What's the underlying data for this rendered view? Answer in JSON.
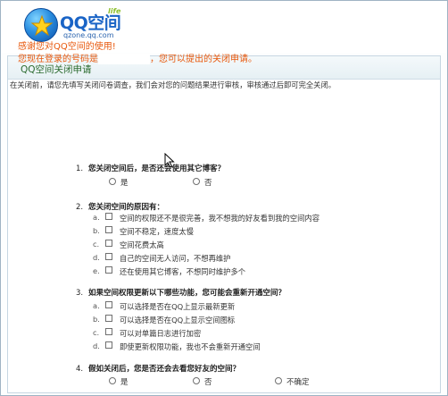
{
  "header": {
    "logo_text": "QQ空间",
    "logo_badge": "life",
    "logo_domain": "qzone.qq.com"
  },
  "panel": {
    "title": "QQ空间关闭申请",
    "thanks_line1": "感谢您对QQ空间的使用!",
    "thanks_line2_prefix": "您现在登录的号码是",
    "thanks_line2_suffix": "，您可以提出的关闭申请。",
    "intro": "在关闭前，请您先填写关闭问卷调查，我们会对您的问题结果进行审核，审核通过后即可完全关闭。"
  },
  "questions": [
    {
      "number": "1.",
      "text": "您关闭空间后，是否还会使用其它博客？",
      "type": "radio",
      "options": [
        "是",
        "否"
      ]
    },
    {
      "number": "2.",
      "text": "您关闭空间的原因有：",
      "type": "checkbox",
      "options": [
        {
          "letter": "a.",
          "label": "空间的权限还不是很完善，我不想我的好友看到我的空间内容"
        },
        {
          "letter": "b.",
          "label": "空间不稳定，速度太慢"
        },
        {
          "letter": "c.",
          "label": "空间花费太高"
        },
        {
          "letter": "d.",
          "label": "自己的空间无人访问，不想再维护"
        },
        {
          "letter": "e.",
          "label": "还在使用其它博客，不想同时维护多个"
        }
      ]
    },
    {
      "number": "3.",
      "text": "如果空间权限更新以下哪些功能，您可能会重新开通空间？",
      "type": "checkbox",
      "options": [
        {
          "letter": "a.",
          "label": "可以选择是否在QQ上显示最新更新"
        },
        {
          "letter": "b.",
          "label": "可以选择是否在QQ上显示空间图标"
        },
        {
          "letter": "c.",
          "label": "可以对单篇日志进行加密"
        },
        {
          "letter": "d.",
          "label": "即使更新权限功能，我也不会重新开通空间"
        }
      ]
    },
    {
      "number": "4.",
      "text": "假如关闭后，您是否还会去看您好友的空间？",
      "type": "radio",
      "options": [
        "是",
        "否",
        "不确定"
      ]
    }
  ],
  "colors": {
    "panel_title": "#2a6a2e",
    "thanks_text": "#e8580c",
    "logo_blue": "#1a64c6",
    "border": "#9fb3c4"
  }
}
